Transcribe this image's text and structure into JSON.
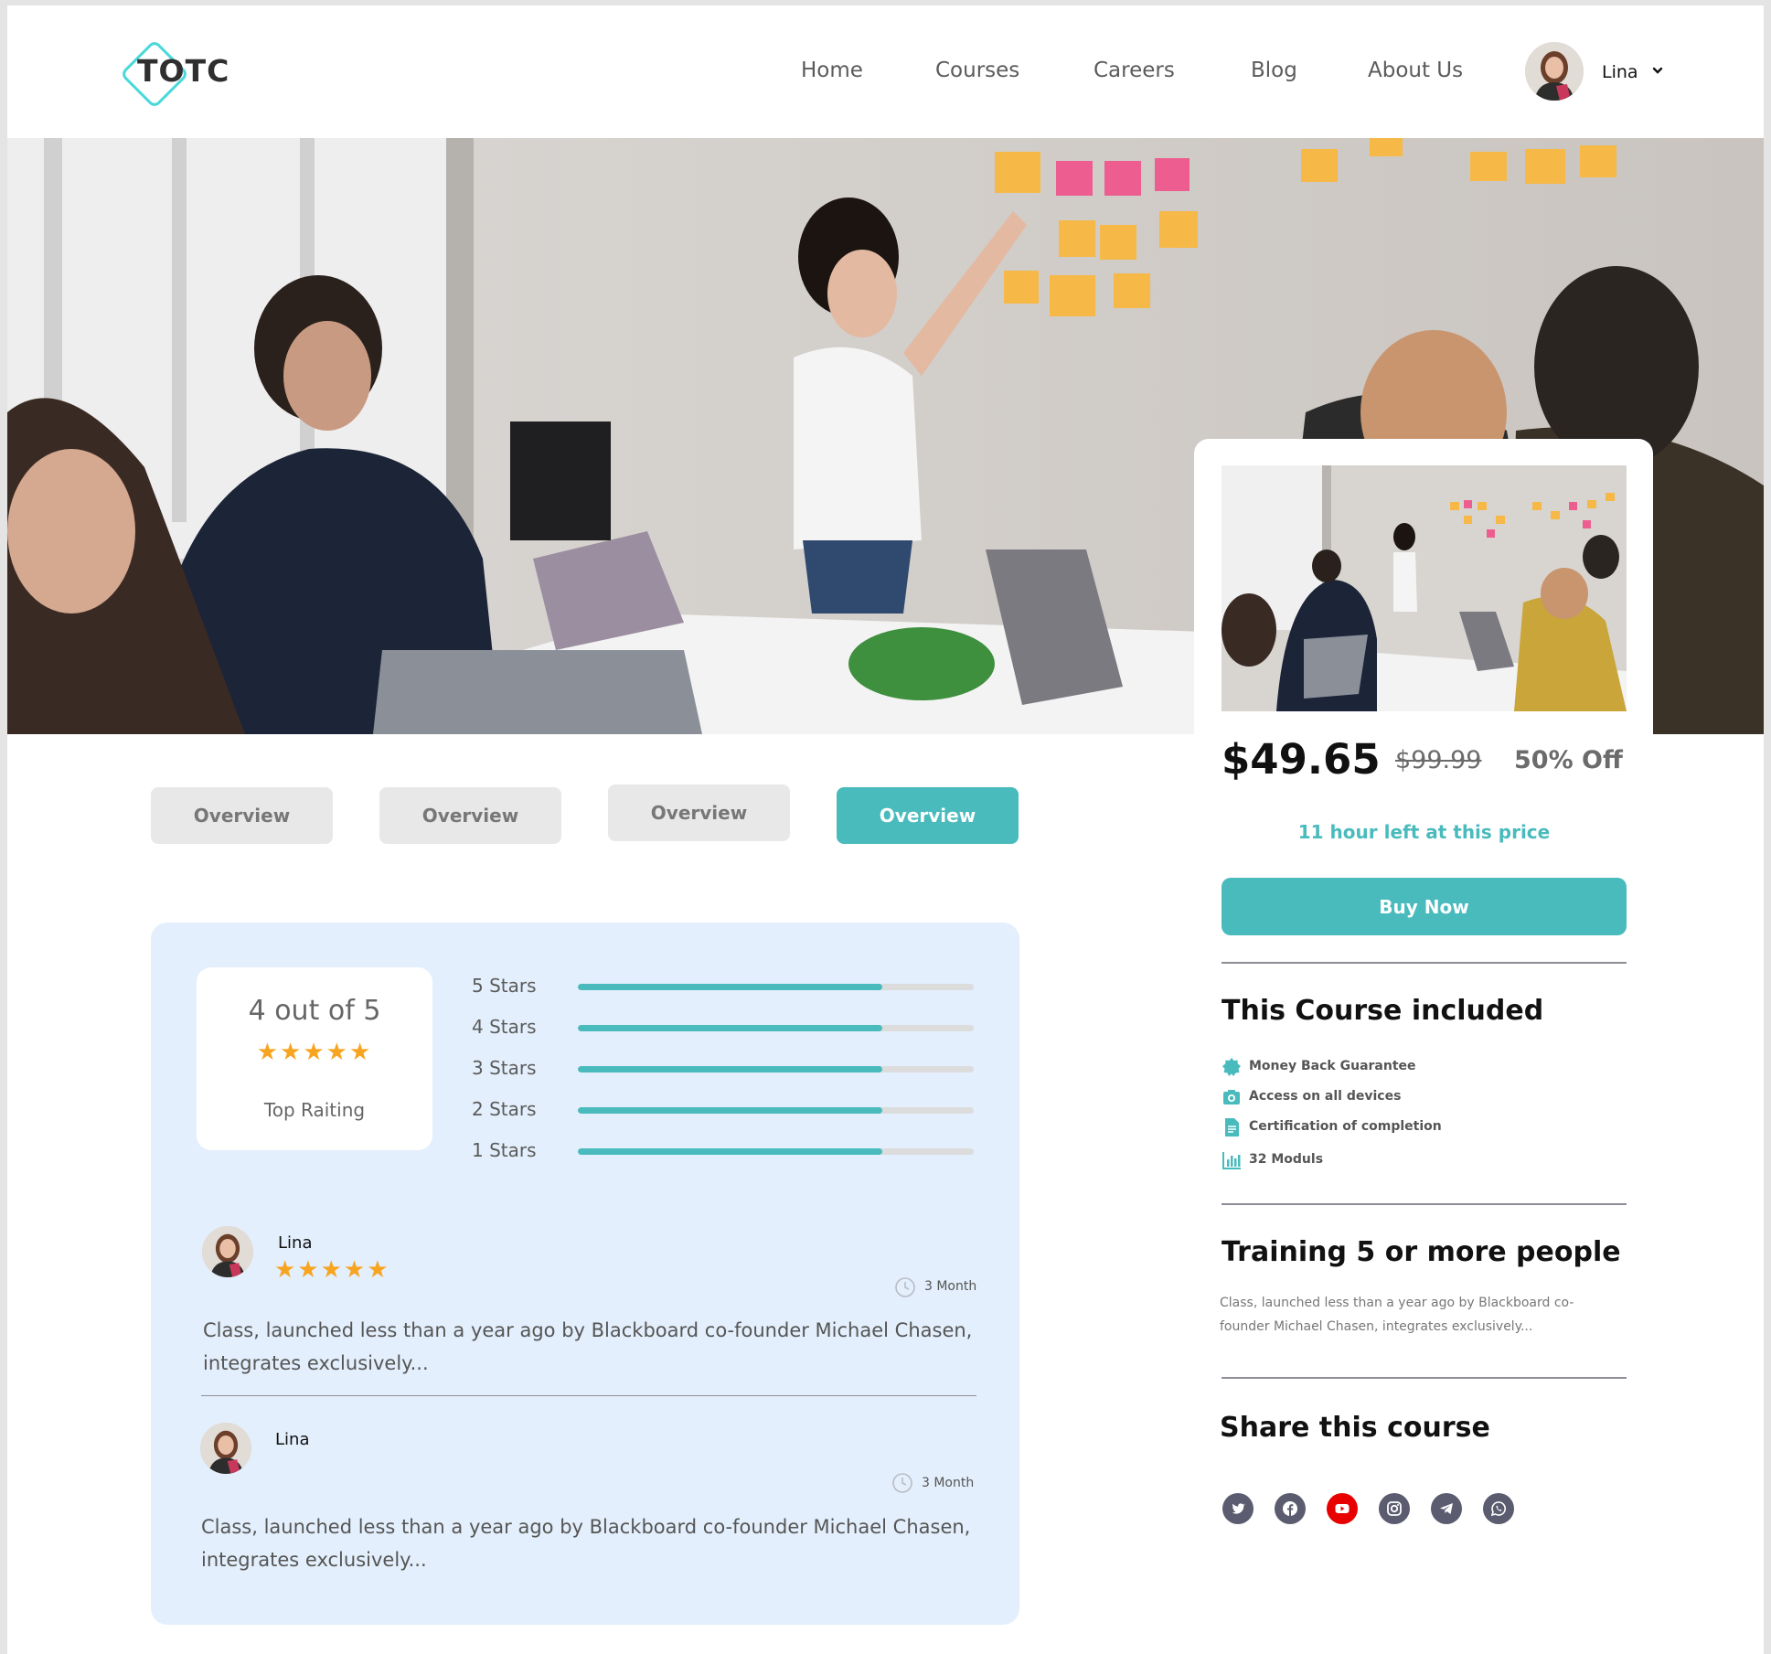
{
  "header": {
    "logo_text": "TOTC",
    "nav": [
      "Home",
      "Courses",
      "Careers",
      "Blog",
      "About Us"
    ],
    "user_name": "Lina"
  },
  "tabs": [
    "Overview",
    "Overview",
    "Overview",
    "Overview"
  ],
  "active_tab": 3,
  "course_card": {
    "price": "$49.65",
    "old_price": "$99.99",
    "discount": "50% Off",
    "time_left": "11 hour left at this price",
    "buy_label": "Buy Now"
  },
  "included": {
    "title": "This Course included",
    "items": [
      "Money Back Guarantee",
      "Access on all devices",
      "Certification of completion",
      "32 Moduls"
    ]
  },
  "training": {
    "title": "Training 5 or more people",
    "text": "Class, launched less than a year ago by Blackboard co-founder Michael Chasen, integrates exclusively..."
  },
  "share": {
    "title": "Share this course",
    "icons": [
      "twitter-icon",
      "facebook-icon",
      "youtube-icon",
      "instagram-icon",
      "telegram-icon",
      "whatsapp-icon"
    ]
  },
  "rating": {
    "summary": "4 out of 5",
    "stars": "★★★★★",
    "label": "Top Raiting",
    "bars": [
      {
        "label": "5 Stars",
        "fraction": 0.77
      },
      {
        "label": "4 Stars",
        "fraction": 0.77
      },
      {
        "label": "3 Stars",
        "fraction": 0.77
      },
      {
        "label": "2 Stars",
        "fraction": 0.77
      },
      {
        "label": "1 Stars",
        "fraction": 0.77
      }
    ]
  },
  "reviews": [
    {
      "name": "Lina",
      "stars": "★★★★★",
      "time": "3 Month",
      "text": "Class, launched less than a year ago by Blackboard co-founder Michael Chasen, integrates exclusively..."
    },
    {
      "name": "Lina",
      "time": "3 Month",
      "text": "Class, launched less than a year ago by Blackboard co-founder Michael Chasen, integrates exclusively..."
    }
  ],
  "colors": {
    "accent": "#49BBBD",
    "panel_bg": "#E3EFFC",
    "star": "#F7A521",
    "logo": "#49D8D9",
    "youtube": "#E80000",
    "social": "#5c5c70"
  }
}
